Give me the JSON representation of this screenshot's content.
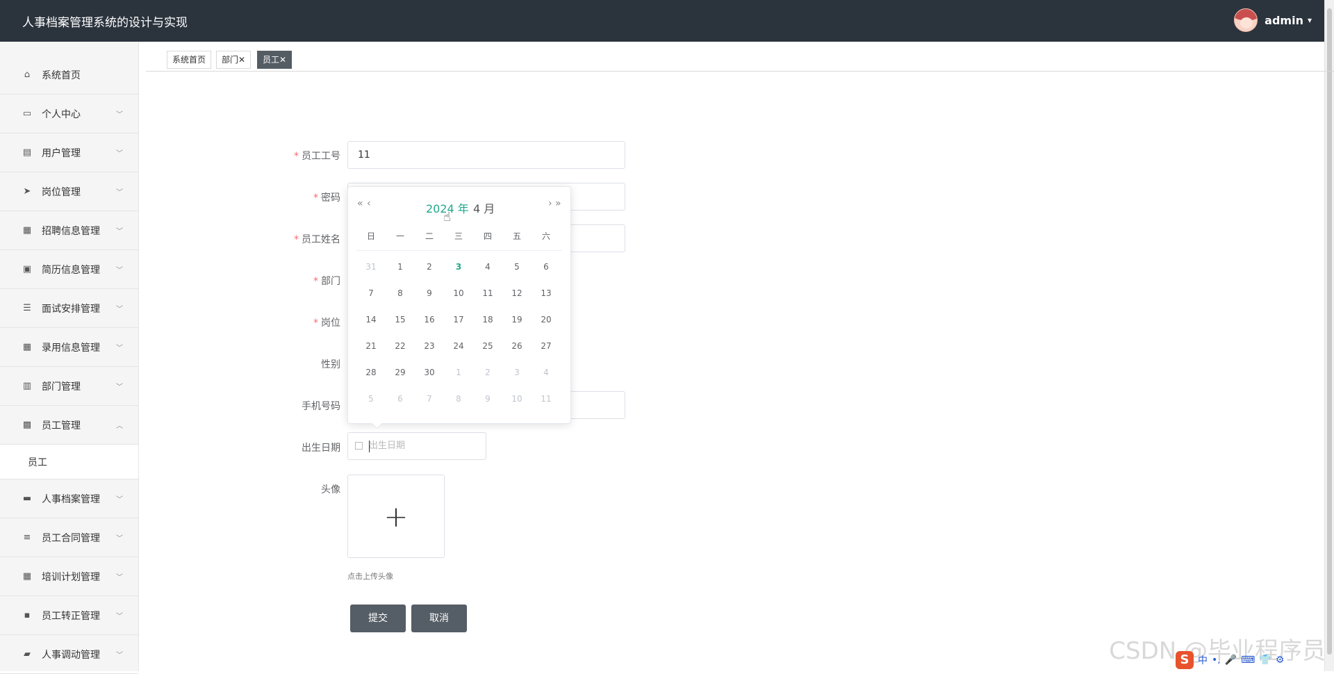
{
  "header": {
    "title": "人事档案管理系统的设计与实现",
    "username": "admin",
    "caret": "▾"
  },
  "sidebar": {
    "items": [
      {
        "label": "系统首页",
        "icon": "home-icon",
        "glyph": "⌂"
      },
      {
        "label": "个人中心",
        "icon": "card-icon",
        "glyph": "▭"
      },
      {
        "label": "用户管理",
        "icon": "clipboard-icon",
        "glyph": "▤"
      },
      {
        "label": "岗位管理",
        "icon": "send-icon",
        "glyph": "➤"
      },
      {
        "label": "招聘信息管理",
        "icon": "grid-icon",
        "glyph": "▦"
      },
      {
        "label": "简历信息管理",
        "icon": "clipboard-check-icon",
        "glyph": "▣"
      },
      {
        "label": "面试安排管理",
        "icon": "list-icon",
        "glyph": "☰"
      },
      {
        "label": "录用信息管理",
        "icon": "grid-icon",
        "glyph": "▦"
      },
      {
        "label": "部门管理",
        "icon": "building-icon",
        "glyph": "▥"
      },
      {
        "label": "员工管理",
        "icon": "apps-icon",
        "glyph": "▩"
      }
    ],
    "open_submenu": "员工",
    "items_after": [
      {
        "label": "人事档案管理",
        "icon": "briefcase-icon",
        "glyph": "▬"
      },
      {
        "label": "员工合同管理",
        "icon": "sliders-icon",
        "glyph": "≡"
      },
      {
        "label": "培训计划管理",
        "icon": "grid-icon",
        "glyph": "▦"
      },
      {
        "label": "员工转正管理",
        "icon": "chat-icon",
        "glyph": "▪"
      },
      {
        "label": "人事调动管理",
        "icon": "ticket-icon",
        "glyph": "▰"
      }
    ]
  },
  "tabs": [
    {
      "label": "系统首页"
    },
    {
      "label": "部门✕"
    },
    {
      "label": "员工✕"
    }
  ],
  "form": {
    "labels": {
      "emp_no": "员工工号",
      "password": "密码",
      "name": "员工姓名",
      "dept": "部门",
      "position": "岗位",
      "gender": "性别",
      "phone": "手机号码",
      "birth": "出生日期",
      "avatar": "头像"
    },
    "emp_no_value": "11",
    "birth_placeholder": "出生日期",
    "upload_hint": "点击上传头像",
    "submit": "提交",
    "cancel": "取消"
  },
  "datepicker": {
    "prev_year": "«",
    "prev_month": "‹",
    "next_month": "›",
    "next_year": "»",
    "year": "2024 年",
    "month": "4 月",
    "weekdays": [
      "日",
      "一",
      "二",
      "三",
      "四",
      "五",
      "六"
    ],
    "weeks": [
      [
        31,
        1,
        2,
        3,
        4,
        5,
        6
      ],
      [
        7,
        8,
        9,
        10,
        11,
        12,
        13
      ],
      [
        14,
        15,
        16,
        17,
        18,
        19,
        20
      ],
      [
        21,
        22,
        23,
        24,
        25,
        26,
        27
      ],
      [
        28,
        29,
        30,
        1,
        2,
        3,
        4
      ],
      [
        5,
        6,
        7,
        8,
        9,
        10,
        11
      ]
    ],
    "today": 3,
    "accent": "#22a88b"
  },
  "watermark": "CSDN @毕业程序员",
  "ime": {
    "logo": "S",
    "items": [
      "中",
      "•,",
      "🎤",
      "⌨",
      "👕",
      "⚙"
    ]
  }
}
